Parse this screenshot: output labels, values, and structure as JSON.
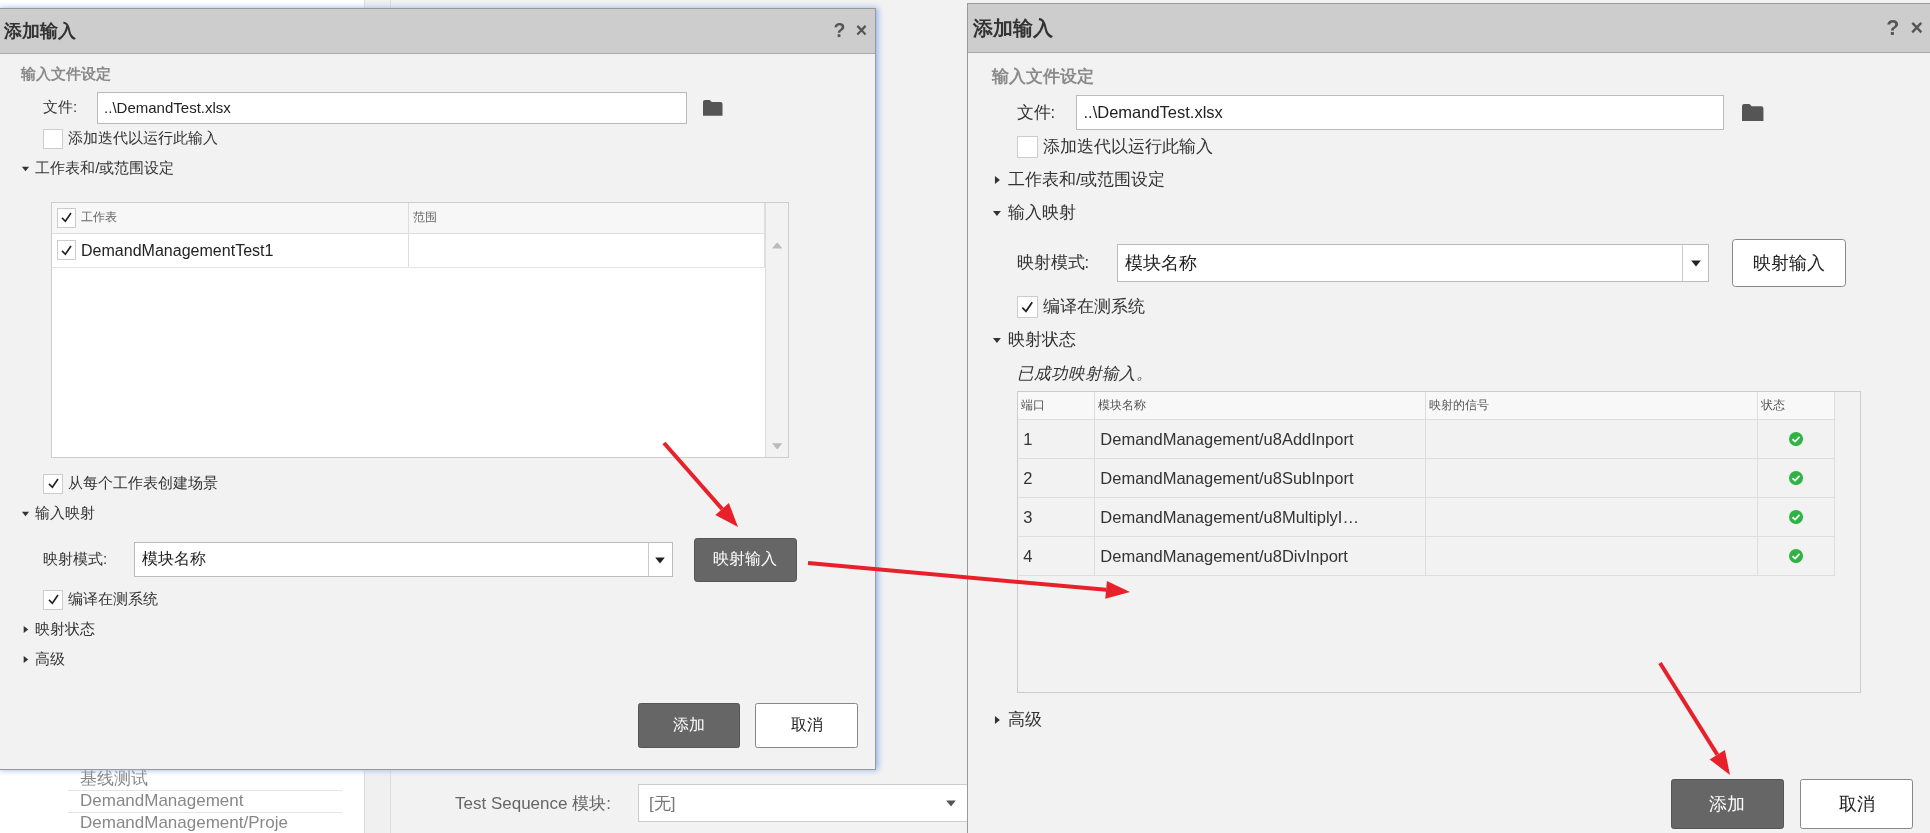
{
  "background": {
    "tree_items": [
      "基线测试",
      "DemandManagement",
      "DemandManagement/Proje"
    ],
    "sequence_field": {
      "label": "Test Sequence 模块:",
      "value": "[无]"
    }
  },
  "dialogs": [
    {
      "title": "添加输入",
      "help": "?",
      "close": "×",
      "file_heading": "输入文件设定",
      "file_label": "文件:",
      "file_value": "..\\DemandTest.xlsx",
      "iterate": {
        "label": "添加迭代以运行此输入",
        "checked": false
      },
      "sections": [
        {
          "kind": "sheets",
          "label": "工作表和/或范围设定",
          "expanded": true,
          "sheet_header": {
            "label": "工作表",
            "checked": true
          },
          "range_header": "范围",
          "rows": [
            {
              "sheet": "DemandManagementTest1",
              "checked": true
            }
          ],
          "scenario": {
            "label": "从每个工作表创建场景",
            "checked": true
          }
        },
        {
          "kind": "mapping",
          "label": "输入映射",
          "expanded": true,
          "mode_label": "映射模式:",
          "mode_value": "模块名称",
          "map_button": {
            "label": "映射输入",
            "primary": true
          },
          "compile": {
            "label": "编译在测系统",
            "checked": true
          }
        },
        {
          "kind": "status",
          "label": "映射状态",
          "expanded": false
        },
        {
          "kind": "advanced",
          "label": "高级",
          "expanded": false
        }
      ],
      "buttons": [
        {
          "label": "添加",
          "primary": true
        },
        {
          "label": "取消",
          "primary": false
        }
      ]
    },
    {
      "title": "添加输入",
      "help": "?",
      "close": "×",
      "file_heading": "输入文件设定",
      "file_label": "文件:",
      "file_value": "..\\DemandTest.xlsx",
      "iterate": {
        "label": "添加迭代以运行此输入",
        "checked": false
      },
      "sections": [
        {
          "kind": "sheets",
          "label": "工作表和/或范围设定",
          "expanded": false
        },
        {
          "kind": "mapping",
          "label": "输入映射",
          "expanded": true,
          "mode_label": "映射模式:",
          "mode_value": "模块名称",
          "map_button": {
            "label": "映射输入",
            "primary": false
          },
          "compile": {
            "label": "编译在测系统",
            "checked": true
          }
        },
        {
          "kind": "status",
          "label": "映射状态",
          "expanded": true,
          "message": "已成功映射输入。",
          "columns": [
            "端口",
            "模块名称",
            "映射的信号",
            "状态"
          ],
          "rows": [
            {
              "port": "1",
              "block": "DemandManagement/u8AddInport",
              "mapped": true
            },
            {
              "port": "2",
              "block": "DemandManagement/u8SubInport",
              "mapped": true
            },
            {
              "port": "3",
              "block": "DemandManagement/u8MultiplyI…",
              "mapped": true
            },
            {
              "port": "4",
              "block": "DemandManagement/u8DivInport",
              "mapped": true
            }
          ]
        },
        {
          "kind": "advanced",
          "label": "高级",
          "expanded": false
        }
      ],
      "buttons": [
        {
          "label": "添加",
          "primary": true
        },
        {
          "label": "取消",
          "primary": false
        }
      ]
    }
  ]
}
